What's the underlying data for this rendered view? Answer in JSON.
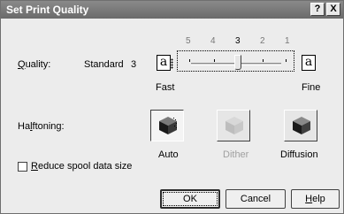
{
  "window": {
    "title": "Set Print Quality",
    "help_glyph": "?",
    "close_glyph": "X"
  },
  "quality": {
    "label_mnemonic": "Q",
    "label_rest": "uality:",
    "current_name": "Standard",
    "current_value": "3",
    "scale": [
      "5",
      "4",
      "3",
      "2",
      "1"
    ],
    "selected_index": 2,
    "left_icon_glyph": "a",
    "right_icon_glyph": "a",
    "left_end_label": "Fast",
    "right_end_label": "Fine"
  },
  "halftoning": {
    "label_before": "Ha",
    "label_mnemonic": "l",
    "label_after": "ftoning:",
    "options": [
      {
        "label": "Auto",
        "state": "selected",
        "icon": "halftone-auto-cube-icon"
      },
      {
        "label": "Dither",
        "state": "disabled",
        "icon": "halftone-dither-cube-icon"
      },
      {
        "label": "Diffusion",
        "state": "normal",
        "icon": "halftone-diffusion-cube-icon"
      }
    ]
  },
  "reduce_spool": {
    "mnemonic": "R",
    "label_rest": "educe spool data size",
    "checked": false
  },
  "buttons": {
    "ok": "OK",
    "cancel": "Cancel",
    "help_mnemonic": "H",
    "help_rest": "elp"
  }
}
